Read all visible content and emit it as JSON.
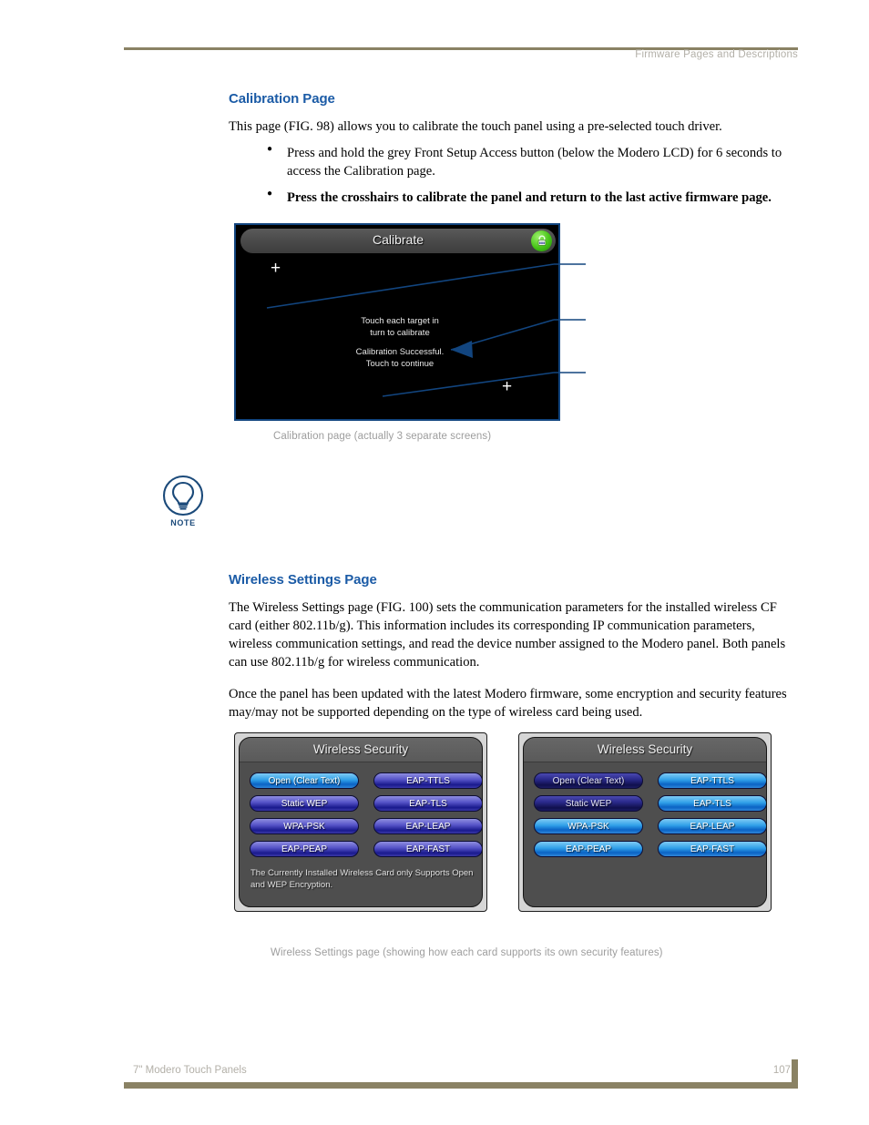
{
  "header": {
    "running_head": "Firmware Pages and Descriptions"
  },
  "footer": {
    "document_title": "7\" Modero Touch Panels",
    "page_number": "107"
  },
  "sections": [
    {
      "heading": "Calibration Page",
      "intro": "This page (FIG. 98) allows you to calibrate the touch panel using a pre-selected touch driver.",
      "bullets": [
        "Press and hold the grey Front Setup Access button (below the Modero LCD) for 6 seconds to access the Calibration page.",
        "Press the crosshairs to calibrate the panel and return to the last active firmware page."
      ]
    },
    {
      "heading": "Wireless Settings Page",
      "paragraph_1": "The Wireless Settings page (FIG. 100) sets the communication parameters for the installed wireless CF card (either 802.11b/g). This information includes its corresponding IP communication parameters, wireless communication settings, and read the device number assigned to the Modero panel. Both panels can use 802.11b/g for wireless communication.",
      "paragraph_2": "Once the panel has been updated with the latest Modero firmware, some encryption and security features may/may not be supported depending on the type of wireless card being used."
    }
  ],
  "calibration_figure": {
    "title": "Calibrate",
    "lock_icon": "green-lock-icon",
    "crosshair_glyph": "+",
    "message_1": "Touch each target in\nturn to calibrate",
    "message_2": "Calibration Successful.\nTouch to continue",
    "caption": "Calibration page (actually 3 separate screens)"
  },
  "note_block": {
    "icon": "lightbulb-icon",
    "label": "NOTE"
  },
  "wireless_figure": {
    "caption": "Wireless Settings page (showing how each card supports its own security features)",
    "panels": [
      {
        "title": "Wireless Security",
        "buttons": [
          {
            "label": "Open (Clear Text)",
            "state": "active"
          },
          {
            "label": "EAP-TTLS",
            "state": "normal"
          },
          {
            "label": "Static WEP",
            "state": "normal"
          },
          {
            "label": "EAP-TLS",
            "state": "normal"
          },
          {
            "label": "WPA-PSK",
            "state": "normal"
          },
          {
            "label": "EAP-LEAP",
            "state": "normal"
          },
          {
            "label": "EAP-PEAP",
            "state": "normal"
          },
          {
            "label": "EAP-FAST",
            "state": "normal"
          }
        ],
        "note": "The Currently Installed Wireless Card only Supports Open and WEP Encryption."
      },
      {
        "title": "Wireless Security",
        "buttons": [
          {
            "label": "Open (Clear Text)",
            "state": "disabled"
          },
          {
            "label": "EAP-TTLS",
            "state": "active"
          },
          {
            "label": "Static WEP",
            "state": "disabled"
          },
          {
            "label": "EAP-TLS",
            "state": "active"
          },
          {
            "label": "WPA-PSK",
            "state": "active"
          },
          {
            "label": "EAP-LEAP",
            "state": "active"
          },
          {
            "label": "EAP-PEAP",
            "state": "active"
          },
          {
            "label": "EAP-FAST",
            "state": "active"
          }
        ],
        "note": ""
      }
    ]
  },
  "colors": {
    "accent_heading": "#1b5ba6",
    "rule": "#8a8264",
    "muted_text": "#b3b0a8",
    "callout_line": "#12457f"
  }
}
